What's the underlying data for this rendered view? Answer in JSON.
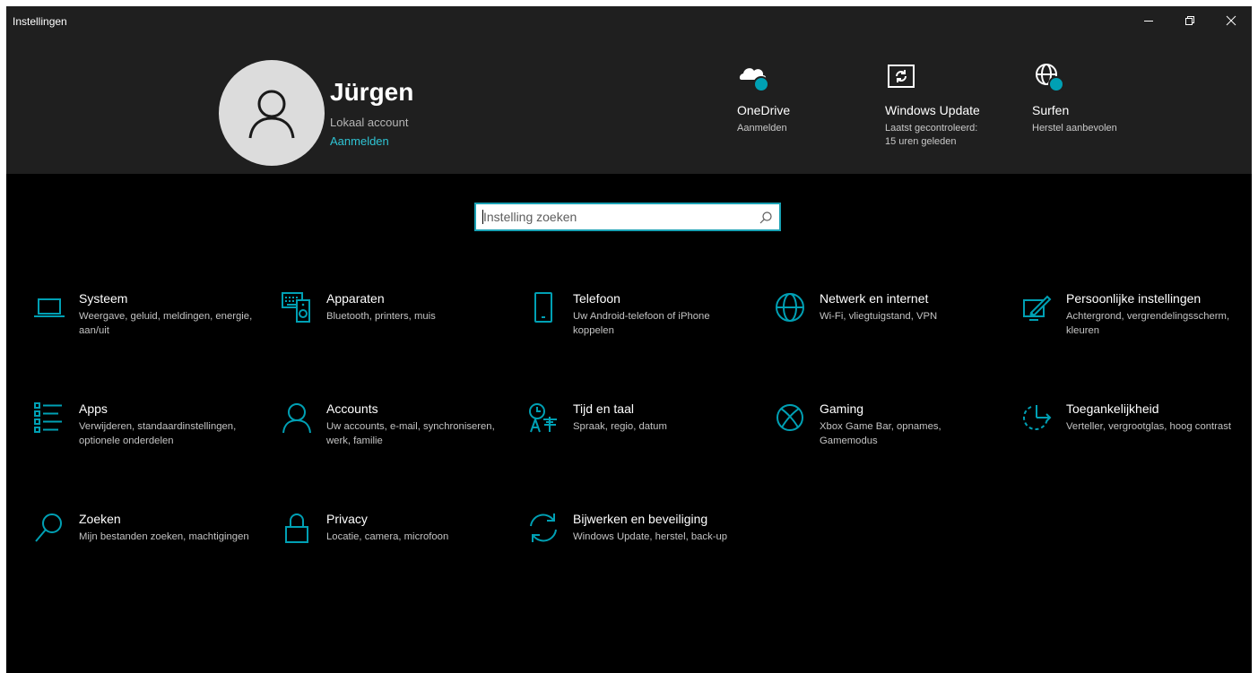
{
  "window": {
    "title": "Instellingen",
    "controls": {
      "minimize": "minimize",
      "restore": "restore",
      "close": "close"
    }
  },
  "account": {
    "name": "Jürgen",
    "type": "Lokaal account",
    "signin": "Aanmelden"
  },
  "status": [
    {
      "icon": "onedrive-icon",
      "title": "OneDrive",
      "subtitle": "Aanmelden",
      "subtitle2": ""
    },
    {
      "icon": "windows-update-icon",
      "title": "Windows Update",
      "subtitle": "Laatst gecontroleerd:",
      "subtitle2": "15 uren geleden"
    },
    {
      "icon": "globe-icon",
      "title": "Surfen",
      "subtitle": "Herstel aanbevolen",
      "subtitle2": ""
    }
  ],
  "search": {
    "placeholder": "Instelling zoeken",
    "value": ""
  },
  "categories": [
    {
      "id": "system",
      "icon": "laptop-icon",
      "title": "Systeem",
      "description": "Weergave, geluid, meldingen, energie, aan/uit"
    },
    {
      "id": "devices",
      "icon": "devices-icon",
      "title": "Apparaten",
      "description": "Bluetooth, printers, muis"
    },
    {
      "id": "phone",
      "icon": "phone-icon",
      "title": "Telefoon",
      "description": "Uw Android-telefoon of iPhone koppelen"
    },
    {
      "id": "network",
      "icon": "globe-icon",
      "title": "Netwerk en internet",
      "description": "Wi-Fi, vliegtuigstand, VPN"
    },
    {
      "id": "personalization",
      "icon": "personalization-icon",
      "title": "Persoonlijke instellingen",
      "description": "Achtergrond, vergrendelingsscherm, kleuren"
    },
    {
      "id": "apps",
      "icon": "apps-list-icon",
      "title": "Apps",
      "description": "Verwijderen, standaardinstellingen, optionele onderdelen"
    },
    {
      "id": "accounts",
      "icon": "person-icon",
      "title": "Accounts",
      "description": "Uw accounts, e-mail, synchroniseren, werk, familie"
    },
    {
      "id": "time",
      "icon": "time-language-icon",
      "title": "Tijd en taal",
      "description": "Spraak, regio, datum"
    },
    {
      "id": "gaming",
      "icon": "xbox-icon",
      "title": "Gaming",
      "description": "Xbox Game Bar, opnames, Gamemodus"
    },
    {
      "id": "ease",
      "icon": "accessibility-icon",
      "title": "Toegankelijkheid",
      "description": "Verteller, vergrootglas, hoog contrast"
    },
    {
      "id": "search",
      "icon": "search-icon",
      "title": "Zoeken",
      "description": "Mijn bestanden zoeken, machtigingen"
    },
    {
      "id": "privacy",
      "icon": "lock-icon",
      "title": "Privacy",
      "description": "Locatie, camera, microfoon"
    },
    {
      "id": "update",
      "icon": "sync-icon",
      "title": "Bijwerken en beveiliging",
      "description": "Windows Update, herstel, back-up"
    }
  ],
  "colors": {
    "accent": "#00a0b4",
    "link": "#2fc4d4",
    "header_bg": "#1f1f1f",
    "body_bg": "#000000"
  }
}
